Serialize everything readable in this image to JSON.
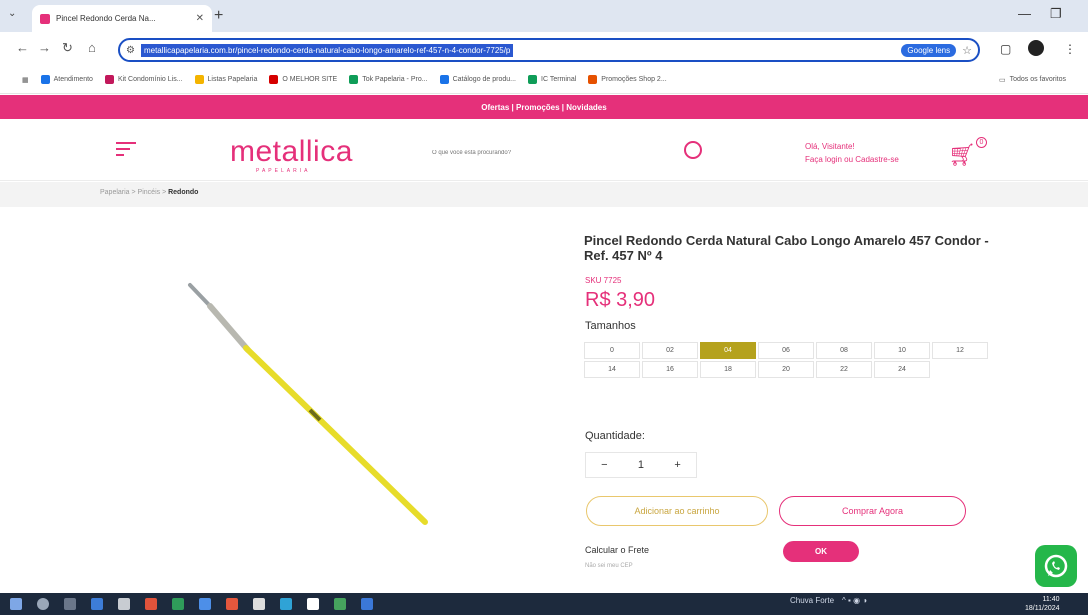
{
  "browser": {
    "tab_title": "Pincel Redondo Cerda Na...",
    "tab_close": "✕",
    "new_tab": "+",
    "tab_list": "⌄",
    "window_controls": [
      "—",
      "❐"
    ],
    "url": "metallicapapelaria.com.br/pincel-redondo-cerda-natural-cabo-longo-amarelo-ref-457-n-4-condor-7725/p",
    "google_lens": "Google lens",
    "nav_icons": [
      "←",
      "→",
      "↻",
      "⌂"
    ],
    "bookmarks": [
      {
        "label": "Atendimento",
        "color": "#1a73e8"
      },
      {
        "label": "Kit Condomínio Lis...",
        "color": "#c2185b"
      },
      {
        "label": "Listas Papelaria",
        "color": "#f4b400"
      },
      {
        "label": "O MELHOR SITE",
        "color": "#d50000"
      },
      {
        "label": "Tok Papelaria - Pro...",
        "color": "#0f9d58"
      },
      {
        "label": "Catálogo de produ...",
        "color": "#1a73e8"
      },
      {
        "label": "IC Terminal",
        "color": "#0f9d58"
      },
      {
        "label": "Promoções Shop 2...",
        "color": "#e65100"
      }
    ],
    "bookmarks_right": "Todos os favoritos"
  },
  "site": {
    "promo": "Ofertas | Promoções | Novidades",
    "logo": "metallica",
    "logo_sub": "PAPELARIA",
    "search_placeholder": "O que você está procurando?",
    "login_line1": "Olá, Visitante!",
    "login_line2": "Faça login ou Cadastre-se",
    "cart_count": "0",
    "breadcrumb_path": "Papelaria > Pincéis >",
    "breadcrumb_current": "Redondo"
  },
  "product": {
    "title": "Pincel Redondo Cerda Natural Cabo Longo Amarelo 457 Condor - Ref. 457 Nº 4",
    "sku": "SKU 7725",
    "price": "R$ 3,90",
    "sizes_label": "Tamanhos",
    "sizes": [
      "0",
      "02",
      "04",
      "06",
      "08",
      "10",
      "12",
      "14",
      "16",
      "18",
      "20",
      "22",
      "24"
    ],
    "selected_size": "04",
    "quantity_label": "Quantidade:",
    "qty_minus": "−",
    "quantity": "1",
    "qty_plus": "+",
    "add_to_cart": "Adicionar ao carrinho",
    "buy_now": "Comprar Agora",
    "freight_label": "Calcular o Frete",
    "zip_hint": "Não sei meu CEP",
    "freight_ok": "OK"
  },
  "taskbar": {
    "tray_weather": "Chuva Forte",
    "tray_icons": "^ ▪ ◉ ◑",
    "time": "11:40",
    "date": "18/11/2024"
  },
  "colors": {
    "brand": "#e5307a",
    "selected_size": "#b5a21d",
    "whatsapp": "#25b74a",
    "taskbar": "#1d2a3d"
  }
}
